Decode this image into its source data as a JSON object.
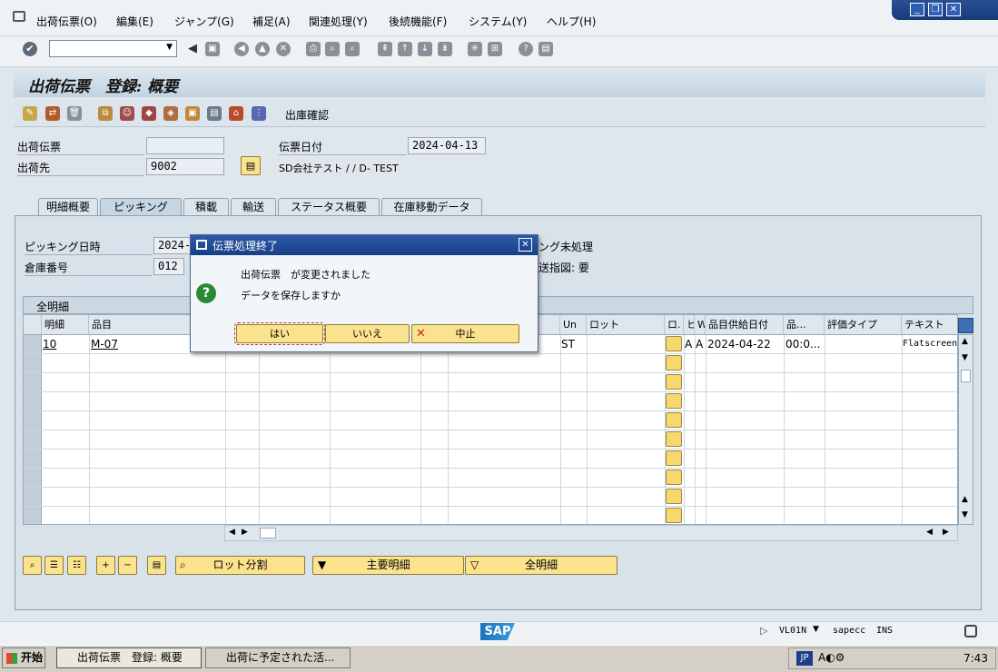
{
  "menubar": {
    "items": [
      "出荷伝票(O)",
      "編集(E)",
      "ジャンプ(G)",
      "補足(A)",
      "関連処理(Y)",
      "後続機能(F)",
      "システム(Y)",
      "ヘルプ(H)"
    ]
  },
  "page": {
    "title": "出荷伝票　登録: 概要"
  },
  "app_toolbar": {
    "goods_issue_label": "出庫確認"
  },
  "header": {
    "delivery_label": "出荷伝票",
    "delivery_value": "",
    "shipto_label": "出荷先",
    "shipto_value": "9002",
    "date_label": "伝票日付",
    "date_value": "2024-04-13",
    "shipto_desc": "SD会社テスト / / D- TEST"
  },
  "tabs": [
    "明細概要",
    "ピッキング",
    "積載",
    "輸送",
    "ステータス概要",
    "在庫移動データ"
  ],
  "picking": {
    "date_label": "ピッキング日時",
    "date_value": "2024-",
    "warehouse_label": "倉庫番号",
    "warehouse_value": "012",
    "status_suffix": "ング未処理",
    "transfer_suffix": "送指図: 要"
  },
  "grid": {
    "title": "全明細",
    "columns": [
      "明細",
      "品目",
      "",
      "",
      "",
      "",
      "",
      "Un",
      "ロット",
      "ロ.",
      "ヒ",
      "W.",
      "品目供給日付",
      "品...",
      "評価タイプ",
      "テキスト"
    ],
    "rows": [
      {
        "item": "10",
        "material": "M-07",
        "unit": "ST",
        "flag1": "A",
        "flag2": "A",
        "avail_date": "2024-04-22",
        "time": "00:0...",
        "text": "Flatscreen"
      }
    ]
  },
  "bottom_buttons": {
    "batch_split": "ロット分割",
    "main_items": "主要明細",
    "all_items": "全明細"
  },
  "status_bar": {
    "transaction": "VL01N",
    "server": "sapecc",
    "mode": "INS"
  },
  "sap_logo": "SAP",
  "taskbar": {
    "start": "开始",
    "tasks": [
      "出荷伝票　登録: 概要",
      "出荷に予定された活..."
    ],
    "lang": "JP",
    "clock": "7:43"
  },
  "dialog": {
    "title": "伝票処理終了",
    "line1": "出荷伝票　が変更されました",
    "line2": "データを保存しますか",
    "yes": "はい",
    "no": "いいえ",
    "cancel": "中止"
  },
  "colors": {
    "title_gradient_start": "#2e5aa8",
    "button_yellow": "#fbe38d",
    "panel": "#d8e2ea"
  }
}
